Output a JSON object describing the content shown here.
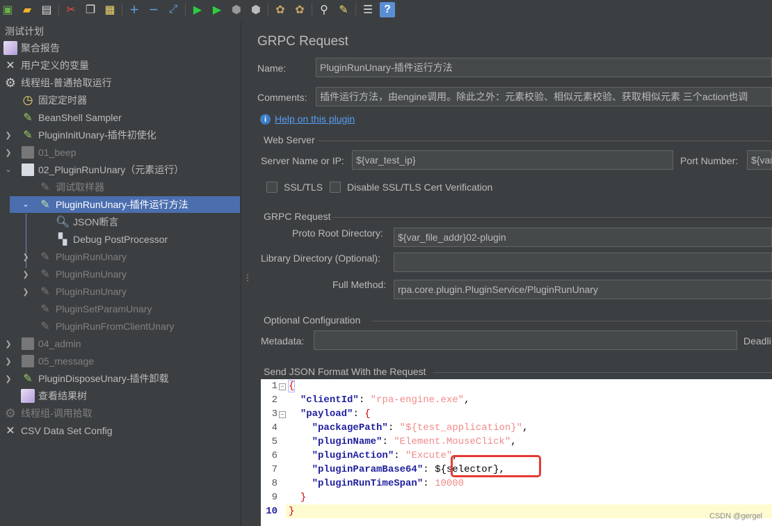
{
  "toolbar": {
    "icons": [
      "templates-icon",
      "open-icon",
      "save-icon",
      "cut-icon",
      "copy-icon",
      "paste-icon",
      "add-icon",
      "remove-icon",
      "toggle-icon",
      "start-icon",
      "start-no-pause-icon",
      "stop-icon",
      "shutdown-icon",
      "clear-icon",
      "clear-all-icon",
      "search-icon",
      "reset-search-icon",
      "function-helper-icon",
      "help-icon"
    ]
  },
  "tree": {
    "root": "测试计划",
    "nodes": [
      {
        "label": "聚合报告"
      },
      {
        "label": "用户定义的变量"
      },
      {
        "label": "线程组-普通拾取运行"
      },
      {
        "label": "固定定时器"
      },
      {
        "label": "BeanShell Sampler"
      },
      {
        "label": "PluginInitUnary-插件初使化"
      },
      {
        "label": "01_beep"
      },
      {
        "label": "02_PluginRunUnary（元素运行）"
      },
      {
        "label": "调试取样器"
      },
      {
        "label": "PluginRunUnary-插件运行方法"
      },
      {
        "label": "JSON断言"
      },
      {
        "label": "Debug PostProcessor"
      },
      {
        "label": "PluginRunUnary"
      },
      {
        "label": "PluginRunUnary"
      },
      {
        "label": "PluginRunUnary"
      },
      {
        "label": "PluginSetParamUnary"
      },
      {
        "label": "PluginRunFromClientUnary"
      },
      {
        "label": "04_admin"
      },
      {
        "label": "05_message"
      },
      {
        "label": "PluginDisposeUnary-插件卸载"
      },
      {
        "label": "查看结果树"
      },
      {
        "label": "线程组-调用拾取"
      },
      {
        "label": "CSV Data Set Config"
      }
    ]
  },
  "panel": {
    "title": "GRPC Request",
    "name_label": "Name:",
    "name_value": "PluginRunUnary-插件运行方法",
    "comments_label": "Comments:",
    "comments_value": "插件运行方法，由engine调用。除此之外：元素校验、相似元素校验、获取相似元素 三个action也调",
    "help_link": "Help on this plugin",
    "web_server": {
      "group": "Web Server",
      "server_label": "Server Name or IP:",
      "server_value": "${var_test_ip}",
      "port_label": "Port Number:",
      "port_value": "${var_",
      "ssl_label": "SSL/TLS",
      "disable_ssl_label": "Disable SSL/TLS Cert Verification"
    },
    "grpc": {
      "group": "GRPC Request",
      "proto_label": "Proto Root Directory:",
      "proto_value": "${var_file_addr}02-plugin",
      "library_label": "Library Directory (Optional):",
      "library_value": "",
      "method_label": "Full Method:",
      "method_value": "rpa.core.plugin.PluginService/PluginRunUnary"
    },
    "optional": {
      "group": "Optional Configuration",
      "metadata_label": "Metadata:",
      "metadata_value": "",
      "deadline_label": "Deadli"
    },
    "json": {
      "group": "Send JSON Format With the Request",
      "line_numbers": [
        "1",
        "2",
        "3",
        "4",
        "5",
        "6",
        "7",
        "8",
        "9",
        "10"
      ],
      "lines": {
        "l1": "{",
        "l2_key": "\"clientId\"",
        "l2_colon": ": ",
        "l2_val": "\"rpa-engine.exe\"",
        "l2_end": ",",
        "l3_key": "\"payload\"",
        "l3_colon": ": ",
        "l3_brace": "{",
        "l4_key": "\"packagePath\"",
        "l4_colon": ": ",
        "l4_val": "\"${test_application}\"",
        "l4_end": ",",
        "l5_key": "\"pluginName\"",
        "l5_colon": ": ",
        "l5_val": "\"Element.MouseClick\"",
        "l5_end": ",",
        "l6_key": "\"pluginAction\"",
        "l6_colon": ": ",
        "l6_val": "\"Excute\"",
        "l6_end": ",",
        "l7_key": "\"pluginParamBase64\"",
        "l7_colon": ": ",
        "l7_val": "${selector}",
        "l7_end": ",",
        "l8_key": "\"pluginRunTimeSpan\"",
        "l8_colon": ": ",
        "l8_val": "10000",
        "l9": "}",
        "l10": "}"
      }
    }
  },
  "watermark": "CSDN @gergel"
}
